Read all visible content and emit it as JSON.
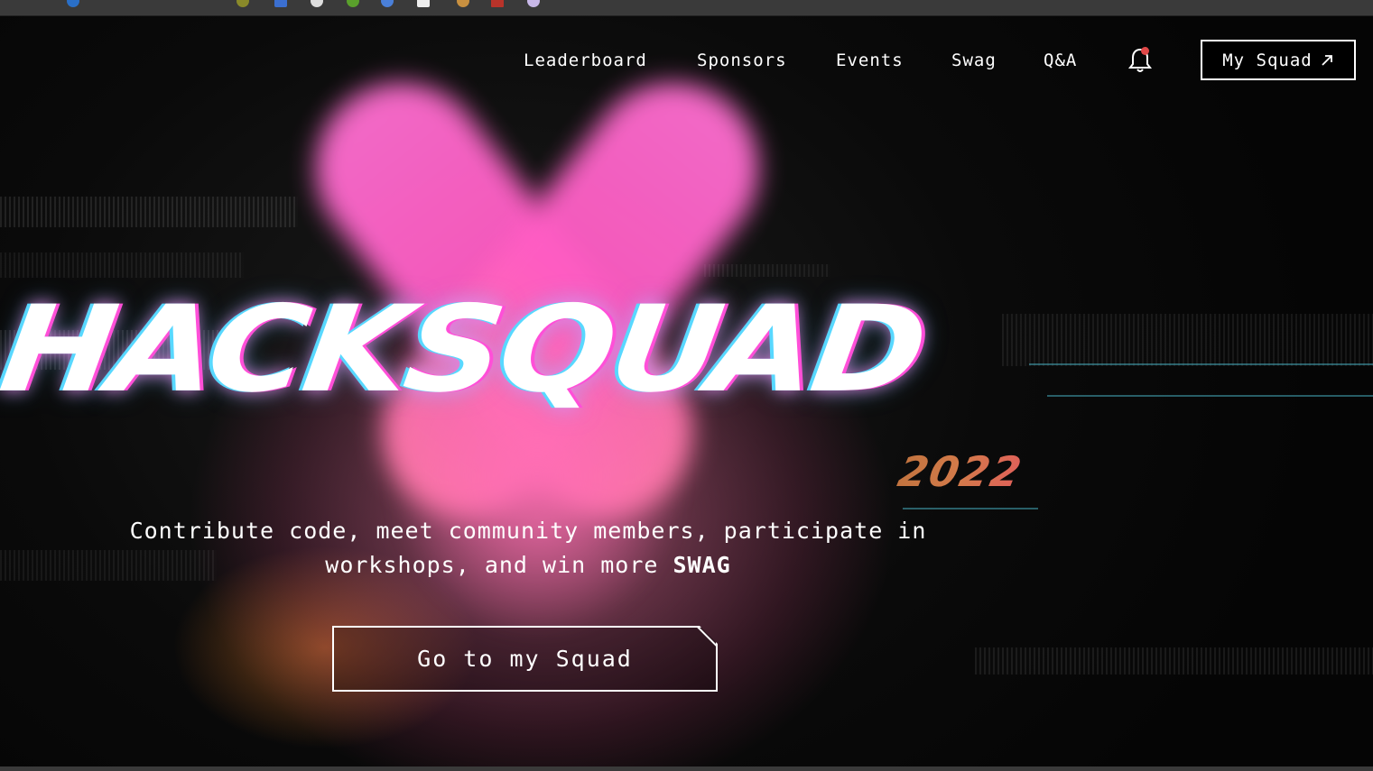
{
  "nav": {
    "links": [
      "Leaderboard",
      "Sponsors",
      "Events",
      "Swag",
      "Q&A"
    ],
    "notification_icon": "bell-icon",
    "my_squad_label": "My Squad",
    "my_squad_icon": "arrow-up-right-icon"
  },
  "hero": {
    "title": "HACKSQUAD",
    "year": "2022",
    "subtitle_line1": "Contribute code, meet community members, participate in",
    "subtitle_line2_prefix": "workshops, and win more ",
    "subtitle_emphasis": "SWAG",
    "cta_label": "Go to my Squad"
  },
  "colors": {
    "accent_pink": "#ff5cc4",
    "glow_cyan": "#58d8ff",
    "year_orange": "#c2743f",
    "notification_dot": "#e04848"
  }
}
